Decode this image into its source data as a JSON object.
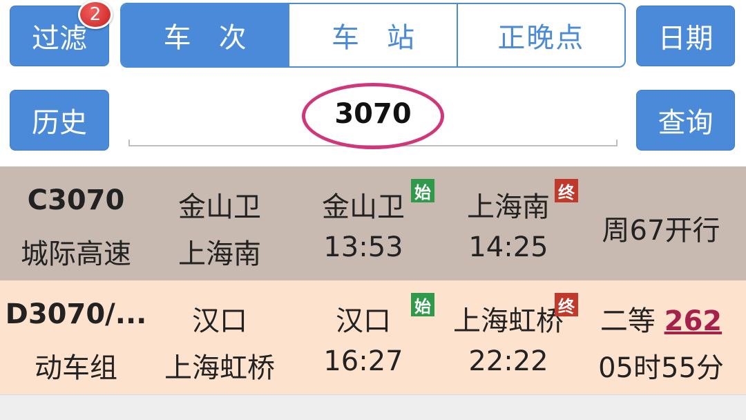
{
  "toolbar": {
    "filter_label": "过滤",
    "filter_badge": "2",
    "date_label": "日期",
    "history_label": "历史",
    "query_label": "查询",
    "tabs": [
      {
        "label": "车次",
        "active": true
      },
      {
        "label": "车站",
        "active": false
      },
      {
        "label": "正晚点",
        "active": false
      }
    ]
  },
  "search": {
    "value": "3070"
  },
  "results": [
    {
      "train_no": "C3070",
      "train_type": "城际高速",
      "from_station": "金山卫",
      "to_station": "上海南",
      "dep_station": "金山卫",
      "dep_time": "13:53",
      "dep_tag": "始",
      "arr_station": "上海南",
      "arr_time": "14:25",
      "arr_tag": "终",
      "info": "周67开行"
    },
    {
      "train_no": "D3070/...",
      "train_type": "动车组",
      "from_station": "汉口",
      "to_station": "上海虹桥",
      "dep_station": "汉口",
      "dep_time": "16:27",
      "dep_tag": "始",
      "arr_station": "上海虹桥",
      "arr_time": "22:22",
      "arr_tag": "终",
      "seat_class": "二等",
      "seat_count": "262",
      "duration": "05时55分"
    }
  ],
  "colors": {
    "accent": "#4a8ad9",
    "row1_bg": "#c8bab0",
    "row2_bg": "#fde3cd",
    "highlight": "#d1357a"
  }
}
